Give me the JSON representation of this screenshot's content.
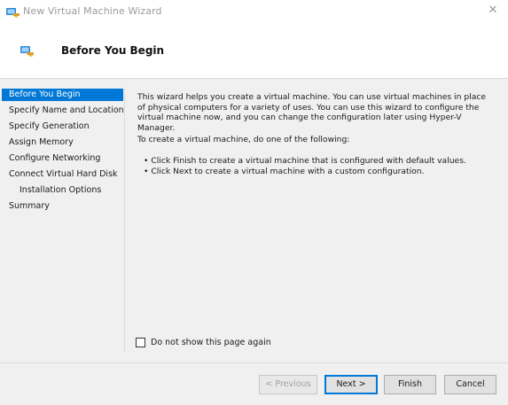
{
  "window": {
    "title": "New Virtual Machine Wizard",
    "close_glyph": "✕"
  },
  "header": {
    "title": "Before You Begin"
  },
  "sidebar": {
    "items": [
      {
        "label": "Before You Begin",
        "selected": true
      },
      {
        "label": "Specify Name and Location"
      },
      {
        "label": "Specify Generation"
      },
      {
        "label": "Assign Memory"
      },
      {
        "label": "Configure Networking"
      },
      {
        "label": "Connect Virtual Hard Disk"
      },
      {
        "label": "Installation Options",
        "indent": true
      },
      {
        "label": "Summary"
      }
    ]
  },
  "content": {
    "intro": "This wizard helps you create a virtual machine. You can use virtual machines in place of physical computers for a variety of uses. You can use this wizard to configure the virtual machine now, and you can change the configuration later using Hyper-V Manager.",
    "instruction": "To create a virtual machine, do one of the following:",
    "bullets": [
      "• Click Finish to create a virtual machine that is configured with default values.",
      "• Click Next to create a virtual machine with a custom configuration."
    ]
  },
  "checkbox": {
    "label": "Do not show this page again",
    "checked": false
  },
  "buttons": {
    "previous": "< Previous",
    "next": "Next >",
    "finish": "Finish",
    "cancel": "Cancel"
  },
  "colors": {
    "accent": "#0078d7",
    "body_bg": "#f0f0f0"
  },
  "icons": {
    "app": "virtual-machine-icon",
    "header": "virtual-machine-icon"
  }
}
